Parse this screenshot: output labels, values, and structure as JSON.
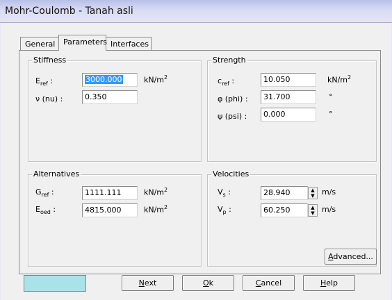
{
  "window": {
    "title": "Mohr-Coulomb - Tanah asli"
  },
  "tabs": [
    {
      "label": "General",
      "active": false
    },
    {
      "label": "Parameters",
      "active": true
    },
    {
      "label": "Interfaces",
      "active": false
    }
  ],
  "stiffness": {
    "title": "Stiffness",
    "eref": {
      "label_main": "E",
      "label_sub": "ref",
      "label_suffix": ":",
      "value": "3000.000",
      "unit_main": "kN/m",
      "unit_sup": "2"
    },
    "nu": {
      "label": "ν (nu) :",
      "value": "0.350"
    }
  },
  "strength": {
    "title": "Strength",
    "cref": {
      "label_main": "c",
      "label_sub": "ref",
      "label_suffix": ":",
      "value": "10.050",
      "unit_main": "kN/m",
      "unit_sup": "2"
    },
    "phi": {
      "label": "φ (phi) :",
      "value": "31.700",
      "unit": "°"
    },
    "psi": {
      "label": "ψ (psi) :",
      "value": "0.000",
      "unit": "°"
    }
  },
  "alternatives": {
    "title": "Alternatives",
    "gref": {
      "label_main": "G",
      "label_sub": "ref",
      "label_suffix": ":",
      "value": "1111.111",
      "unit_main": "kN/m",
      "unit_sup": "2"
    },
    "eoed": {
      "label_main": "E",
      "label_sub": "oed",
      "label_suffix": ":",
      "value": "4815.000",
      "unit_main": "kN/m",
      "unit_sup": "2"
    }
  },
  "velocities": {
    "title": "Velocities",
    "vs": {
      "label_main": "V",
      "label_sub": "s",
      "label_suffix": ":",
      "value": "28.940",
      "unit": "m/s"
    },
    "vp": {
      "label_main": "V",
      "label_sub": "p",
      "label_suffix": ":",
      "value": "60.250",
      "unit": "m/s"
    }
  },
  "buttons": {
    "advanced": {
      "mnemonic": "A",
      "rest": "dvanced..."
    },
    "next": {
      "mnemonic": "N",
      "rest": "ext"
    },
    "ok": {
      "mnemonic": "O",
      "rest": "k"
    },
    "cancel": {
      "mnemonic": "C",
      "rest": "ancel"
    },
    "help": {
      "mnemonic": "H",
      "rest": "elp"
    }
  },
  "colors": {
    "material_color": "#a9e3e8",
    "selection": "#3399ff"
  }
}
